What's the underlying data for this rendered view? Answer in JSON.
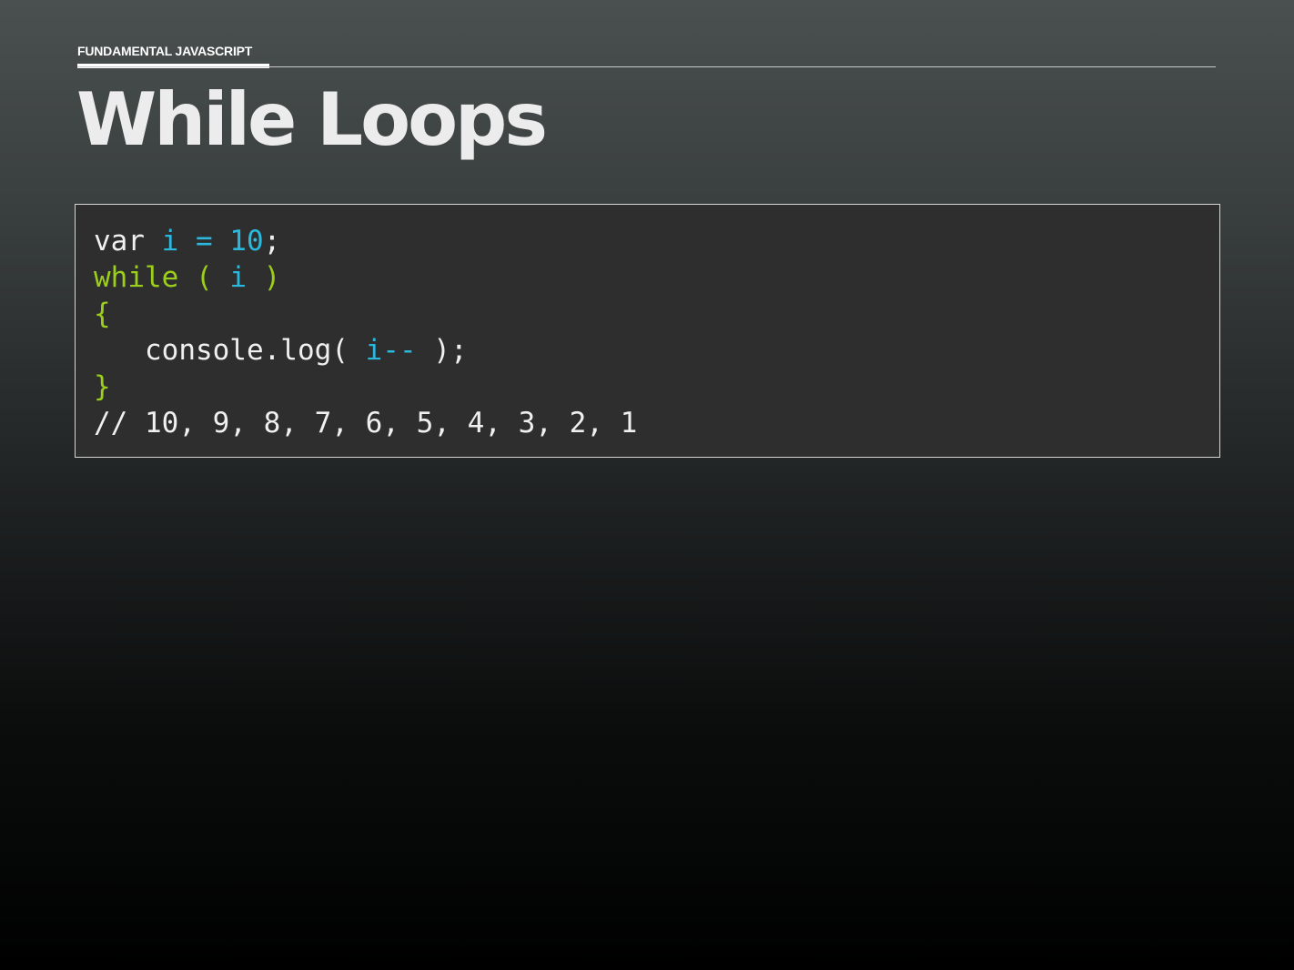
{
  "header": {
    "section": "FUNDAMENTAL JAVASCRIPT",
    "title": "While Loops"
  },
  "colors": {
    "plain": "#f0f0f0",
    "variable": "#2bb8dd",
    "keyword": "#9ccf1c",
    "code_background": "#2e2e2e"
  },
  "code": {
    "lines": [
      {
        "tokens": [
          {
            "text": "var ",
            "kind": "plain"
          },
          {
            "text": "i = 10",
            "kind": "variable"
          },
          {
            "text": ";",
            "kind": "plain"
          }
        ]
      },
      {
        "tokens": [
          {
            "text": "while ( ",
            "kind": "keyword"
          },
          {
            "text": "i",
            "kind": "variable"
          },
          {
            "text": " )",
            "kind": "keyword"
          }
        ]
      },
      {
        "tokens": [
          {
            "text": "{",
            "kind": "keyword"
          }
        ]
      },
      {
        "tokens": [
          {
            "text": "   console.log( ",
            "kind": "plain"
          },
          {
            "text": "i--",
            "kind": "variable"
          },
          {
            "text": " );",
            "kind": "plain"
          }
        ]
      },
      {
        "tokens": [
          {
            "text": "}",
            "kind": "keyword"
          }
        ]
      },
      {
        "tokens": [
          {
            "text": "// 10, 9, 8, 7, 6, 5, 4, 3, 2, 1",
            "kind": "plain"
          }
        ]
      }
    ]
  }
}
